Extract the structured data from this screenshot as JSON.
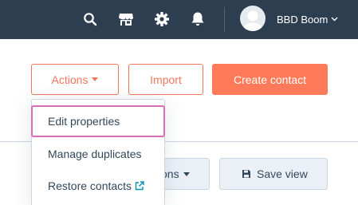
{
  "topnav": {
    "icons": [
      "search-icon",
      "marketplace-icon",
      "gear-icon",
      "bell-icon"
    ],
    "account_name": "BBD Boom",
    "colors": {
      "bar": "#2d3e50"
    }
  },
  "actions": {
    "actions_label": "Actions",
    "import_label": "Import",
    "create_label": "Create contact",
    "colors": {
      "accent": "#ff7a59"
    }
  },
  "dropdown": {
    "items": [
      {
        "label": "Edit properties"
      },
      {
        "label": "Manage duplicates"
      },
      {
        "label": "Restore contacts",
        "icon": "external-link-icon"
      }
    ],
    "focus_color": "#d66fb5"
  },
  "secondary": {
    "options_label": "ons",
    "save_view_label": "Save view"
  }
}
